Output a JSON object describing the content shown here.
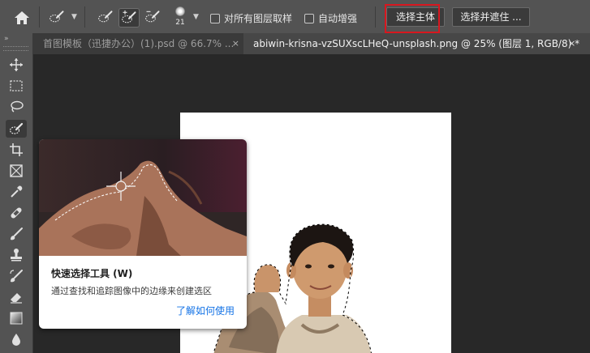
{
  "options_bar": {
    "home_icon": "home-icon",
    "tool_preset_icon": "quick-selection-icon",
    "mode_new_icon": "new-selection-brush-icon",
    "mode_add_icon": "add-to-selection-brush-icon",
    "mode_subtract_icon": "subtract-from-selection-brush-icon",
    "brush_size": "21",
    "sample_all_layers_label": "对所有图层取样",
    "auto_enhance_label": "自动增强",
    "select_subject_label": "选择主体",
    "select_and_mask_label": "选择并遮住 ..."
  },
  "tabs": [
    {
      "label": "首图模板（迅捷办公）(1).psd @ 66.7% ...",
      "close": "×",
      "active": false
    },
    {
      "label": "abiwin-krisna-vzSUXscLHeQ-unsplash.png @ 25% (图层 1, RGB/8) *",
      "close": "×",
      "active": true
    }
  ],
  "toolbar": {
    "collapse_label": "»",
    "tools": [
      {
        "name": "move-tool",
        "icon": "move-icon"
      },
      {
        "name": "marquee-tool",
        "icon": "rectangle-marquee-icon"
      },
      {
        "name": "lasso-tool",
        "icon": "lasso-icon"
      },
      {
        "name": "quick-selection-tool",
        "icon": "quick-selection-icon",
        "active": true
      },
      {
        "name": "crop-tool",
        "icon": "crop-icon"
      },
      {
        "name": "frame-tool",
        "icon": "frame-icon"
      },
      {
        "name": "eyedropper-tool",
        "icon": "eyedropper-icon"
      },
      {
        "name": "healing-brush-tool",
        "icon": "bandage-icon"
      },
      {
        "name": "brush-tool",
        "icon": "brush-icon"
      },
      {
        "name": "clone-stamp-tool",
        "icon": "stamp-icon"
      },
      {
        "name": "history-brush-tool",
        "icon": "history-brush-icon"
      },
      {
        "name": "eraser-tool",
        "icon": "eraser-icon"
      },
      {
        "name": "gradient-tool",
        "icon": "gradient-icon"
      },
      {
        "name": "blur-tool",
        "icon": "drop-icon"
      }
    ]
  },
  "tooltip": {
    "title": "快速选择工具 (W)",
    "description": "通过查找和追踪图像中的边缘来创建选区",
    "link": "了解如何使用"
  },
  "colors": {
    "highlight": "#d8171f",
    "link": "#1473e6",
    "panel": "#535353",
    "canvas_bg": "#282828"
  }
}
